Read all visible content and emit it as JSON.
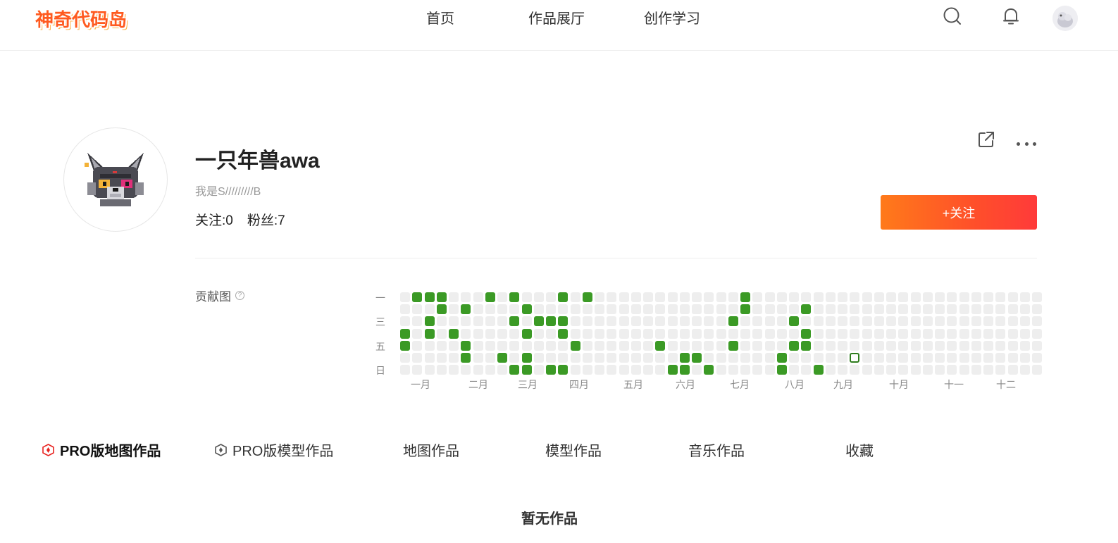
{
  "header": {
    "logo_text": "神奇代码岛",
    "nav": [
      {
        "label": "首页"
      },
      {
        "label": "作品展厅"
      },
      {
        "label": "创作学习"
      }
    ]
  },
  "profile": {
    "username": "一只年兽awa",
    "bio": "我是S/////////B",
    "following": "关注:0",
    "followers": "粉丝:7",
    "follow_button": "+关注"
  },
  "contributions": {
    "label": "贡献图",
    "help": "?",
    "day_labels": [
      "一",
      "三",
      "五",
      "日"
    ],
    "months": [
      "一月",
      "二月",
      "三月",
      "四月",
      "五月",
      "六月",
      "七月",
      "八月",
      "九月",
      "十月",
      "十一",
      "十二"
    ],
    "weeks": 53,
    "active_cells": [
      [
        1,
        0
      ],
      [
        2,
        0
      ],
      [
        3,
        0
      ],
      [
        7,
        0
      ],
      [
        9,
        0
      ],
      [
        13,
        0
      ],
      [
        15,
        0
      ],
      [
        28,
        0
      ],
      [
        3,
        1
      ],
      [
        5,
        1
      ],
      [
        10,
        1
      ],
      [
        28,
        1
      ],
      [
        33,
        1
      ],
      [
        2,
        2
      ],
      [
        9,
        2
      ],
      [
        11,
        2
      ],
      [
        12,
        2
      ],
      [
        13,
        2
      ],
      [
        27,
        2
      ],
      [
        32,
        2
      ],
      [
        0,
        3
      ],
      [
        2,
        3
      ],
      [
        4,
        3
      ],
      [
        10,
        3
      ],
      [
        13,
        3
      ],
      [
        33,
        3
      ],
      [
        0,
        4
      ],
      [
        5,
        4
      ],
      [
        14,
        4
      ],
      [
        21,
        4
      ],
      [
        27,
        4
      ],
      [
        32,
        4
      ],
      [
        33,
        4
      ],
      [
        5,
        5
      ],
      [
        8,
        5
      ],
      [
        10,
        5
      ],
      [
        23,
        5
      ],
      [
        24,
        5
      ],
      [
        31,
        5
      ],
      [
        9,
        6
      ],
      [
        10,
        6
      ],
      [
        12,
        6
      ],
      [
        13,
        6
      ],
      [
        22,
        6
      ],
      [
        23,
        6
      ],
      [
        25,
        6
      ],
      [
        31,
        6
      ],
      [
        34,
        6
      ]
    ],
    "today_cell": [
      37,
      5
    ],
    "colors": {
      "active": "#3b9a25",
      "empty": "#eeeeee"
    }
  },
  "tabs": [
    {
      "label": "PRO版地图作品",
      "active": true,
      "icon": "pro-map-icon"
    },
    {
      "label": "PRO版模型作品",
      "active": false,
      "icon": "pro-model-icon"
    },
    {
      "label": "地图作品",
      "active": false
    },
    {
      "label": "模型作品",
      "active": false
    },
    {
      "label": "音乐作品",
      "active": false
    },
    {
      "label": "收藏",
      "active": false
    }
  ],
  "empty_state": "暂无作品",
  "colors": {
    "accent_start": "#ff7a1a",
    "accent_end": "#ff3a3a",
    "active_tab_icon": "#e8221f"
  }
}
